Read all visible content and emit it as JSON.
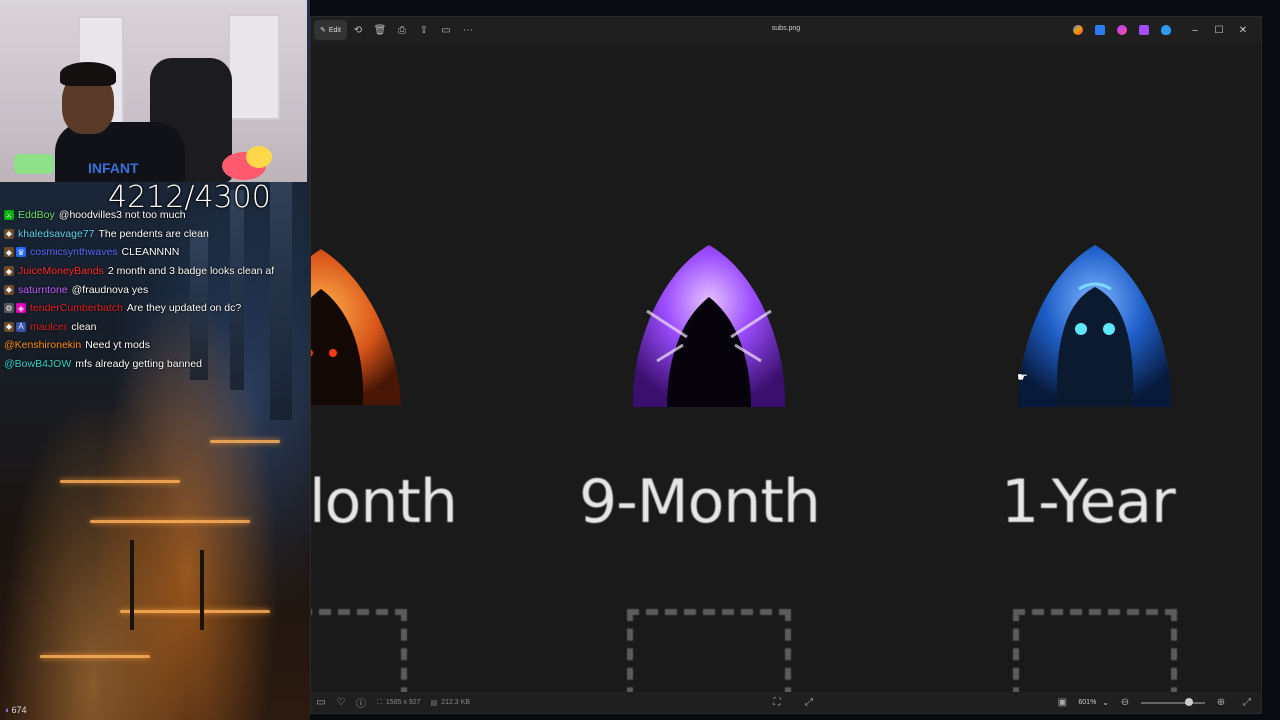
{
  "stream": {
    "sub_counter": "4212/4300",
    "chat": [
      {
        "user": "EddBoy",
        "user_color": "#6fdc6f",
        "message": "@hoodvilles3 not too much",
        "badges": [
          "mod"
        ]
      },
      {
        "user": "khaledsavage77",
        "user_color": "#5fd0e8",
        "message": "The pendents are clean",
        "badges": [
          "sub"
        ]
      },
      {
        "user": "cosmicsynthwaves",
        "user_color": "#5a6bff",
        "message": "CLEANNNN",
        "badges": [
          "sub",
          "prime"
        ]
      },
      {
        "user": "JuiceMoneyBands",
        "user_color": "#ff2a2a",
        "message": "2 month and 3 badge looks clean af",
        "badges": [
          "sub"
        ]
      },
      {
        "user": "saturntone",
        "user_color": "#c45cff",
        "message": "@fraudnova yes",
        "badges": [
          "sub"
        ]
      },
      {
        "user": "tenderCumberbatch",
        "user_color": "#e02020",
        "message": "Are they updated on dc?",
        "badges": [
          "gear",
          "vip"
        ]
      },
      {
        "user": "maulcer",
        "user_color": "#d42424",
        "message": "clean",
        "badges": [
          "sub",
          "a"
        ]
      },
      {
        "user": "@Kenshironekin",
        "user_color": "#ff8c1a",
        "message": "Need yt mods",
        "badges": []
      },
      {
        "user": "@BowB4JOW",
        "user_color": "#2fd4c8",
        "message": "mfs already getting banned",
        "badges": []
      }
    ],
    "tray_count": "674"
  },
  "app": {
    "edit_label": "Edit",
    "file_name": "subs.png",
    "window_controls": {
      "minimize": "–",
      "maximize": "☐",
      "close": "✕"
    },
    "image": {
      "captions": [
        "lonth",
        "9-Month",
        "1-Year"
      ]
    },
    "status": {
      "dimensions": "1585 x 927",
      "file_size": "212.3 KB",
      "zoom": "601%",
      "zoom_level": 0.75
    }
  },
  "colors": {
    "window_bg": "#1c1c1c",
    "canvas_bg": "#1a1a1a",
    "orange_hood": "#ff7a1a",
    "purple_hood": "#8a3cff",
    "blue_hood": "#2a6ad8"
  }
}
